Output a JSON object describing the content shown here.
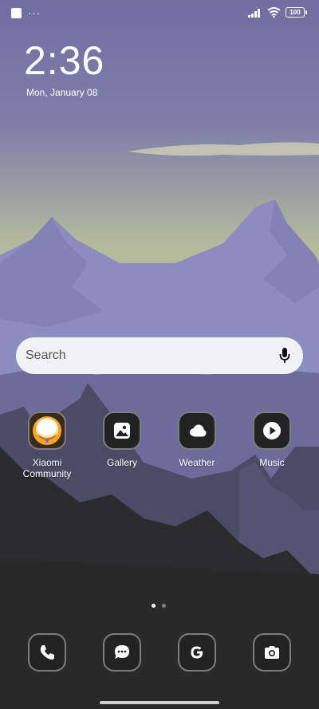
{
  "status_bar": {
    "overflow_indicator": "···",
    "battery_level": "100",
    "icons": [
      "notification-square-icon",
      "signal-icon",
      "wifi-icon",
      "battery-icon"
    ]
  },
  "clock": {
    "time": "2:36",
    "date": "Mon, January 08"
  },
  "search": {
    "placeholder": "Search",
    "mic_icon": "microphone-icon"
  },
  "apps": [
    {
      "label": "Xiaomi\nCommunity",
      "icon": "xiaomi-community-icon"
    },
    {
      "label": "Gallery",
      "icon": "gallery-icon"
    },
    {
      "label": "Weather",
      "icon": "weather-icon"
    },
    {
      "label": "Music",
      "icon": "music-icon"
    }
  ],
  "pager": {
    "pages": 2,
    "current": 1
  },
  "dock": [
    "phone-icon",
    "messages-icon",
    "google-icon",
    "camera-icon"
  ],
  "colors": {
    "sky_top": "#7474a6",
    "sky_horizon": "#b3b99c",
    "mountain": "#8a8dbd",
    "foreground": "#2a2a2a",
    "icon_bg": "#222222",
    "search_bg": "#f2f2f4"
  }
}
